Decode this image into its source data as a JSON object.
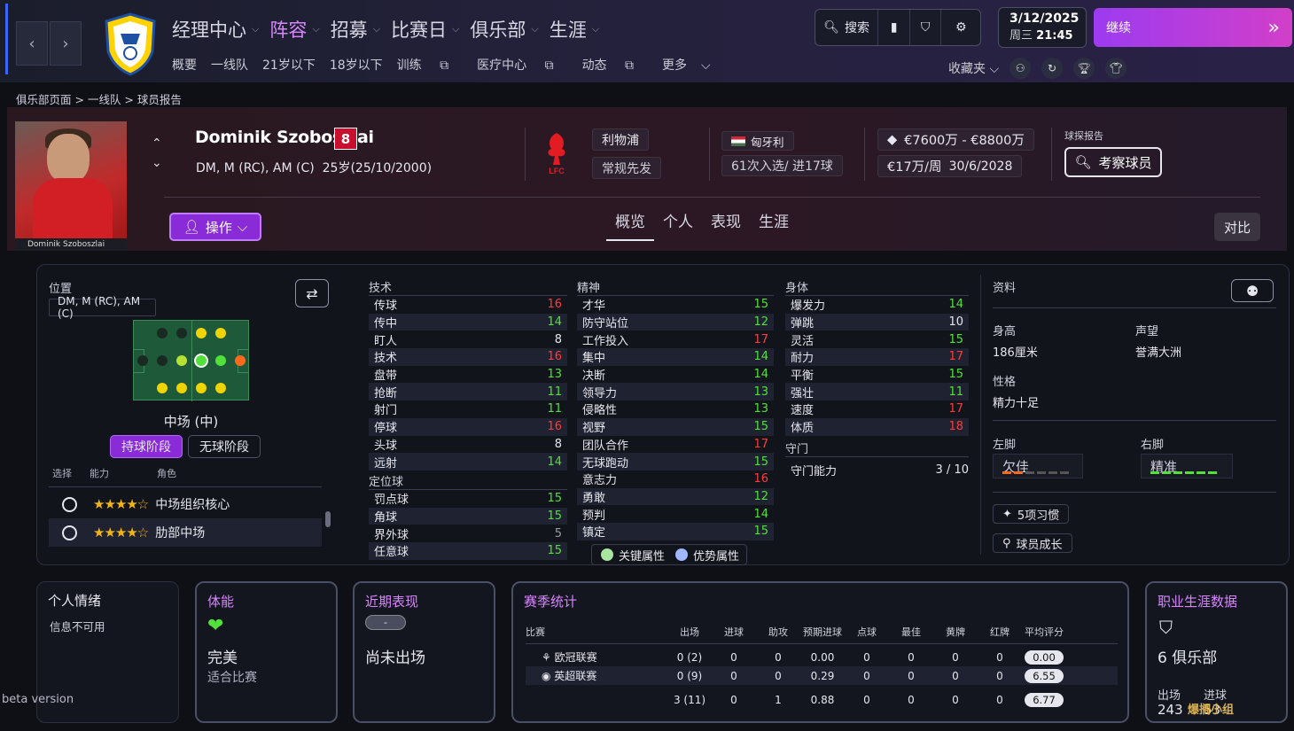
{
  "nav": {
    "main": [
      "经理中心",
      "阵容",
      "招募",
      "比赛日",
      "俱乐部",
      "生涯"
    ],
    "active": 1,
    "sub": [
      "概要",
      "一线队",
      "21岁以下",
      "18岁以下",
      "训练",
      "医疗中心",
      "动态",
      "更多"
    ],
    "search": "搜索",
    "bookmarks": "收藏夹"
  },
  "date": {
    "day": "3/12/2025",
    "weekday": "周三",
    "time": "21:45"
  },
  "continue": "继续",
  "breadcrumb": [
    "俱乐部页面",
    "一线队",
    "球员报告"
  ],
  "player": {
    "name": "Dominik Szoboszlai",
    "number": "8",
    "positions": "DM, M (RC), AM (C)",
    "age": "25岁(25/10/2000)",
    "photo_caption": "Dominik Szoboszlai",
    "club": "利物浦",
    "club_badge_text": "LFC",
    "squad_status": "常规先发",
    "nationality": "匈牙利",
    "caps": "61次入选/ 进17球",
    "value": "€7600万 - €8800万",
    "wage": "€17万/周",
    "contract": "30/6/2028",
    "scout_label": "球探报告",
    "scout_button": "考察球员"
  },
  "actions": "操作",
  "tabs": [
    "概览",
    "个人",
    "表现",
    "生涯"
  ],
  "compare": "对比",
  "position": {
    "label": "位置",
    "value": "DM, M (RC), AM (C)",
    "role": "中场 (中)",
    "phase_on": "持球阶段",
    "phase_off": "无球阶段",
    "hdr_select": "选择",
    "hdr_ability": "能力",
    "hdr_role": "角色",
    "roles": [
      {
        "stars": "★★★★☆",
        "name": "中场组织核心"
      },
      {
        "stars": "★★★★☆",
        "name": "肋部中场"
      }
    ]
  },
  "technical": {
    "title": "技术",
    "items": [
      [
        "传球",
        "16"
      ],
      [
        "传中",
        "14"
      ],
      [
        "盯人",
        "8"
      ],
      [
        "技术",
        "16"
      ],
      [
        "盘带",
        "13"
      ],
      [
        "抢断",
        "11"
      ],
      [
        "射门",
        "11"
      ],
      [
        "停球",
        "16"
      ],
      [
        "头球",
        "8"
      ],
      [
        "远射",
        "14"
      ]
    ]
  },
  "setpieces": {
    "title": "定位球",
    "items": [
      [
        "罚点球",
        "15"
      ],
      [
        "角球",
        "15"
      ],
      [
        "界外球",
        "5"
      ],
      [
        "任意球",
        "15"
      ]
    ]
  },
  "mental": {
    "title": "精神",
    "items": [
      [
        "才华",
        "15"
      ],
      [
        "防守站位",
        "12"
      ],
      [
        "工作投入",
        "17"
      ],
      [
        "集中",
        "14"
      ],
      [
        "决断",
        "14"
      ],
      [
        "领导力",
        "13"
      ],
      [
        "侵略性",
        "13"
      ],
      [
        "视野",
        "15"
      ],
      [
        "团队合作",
        "17"
      ],
      [
        "无球跑动",
        "15"
      ],
      [
        "意志力",
        "16"
      ],
      [
        "勇敢",
        "12"
      ],
      [
        "预判",
        "14"
      ],
      [
        "镇定",
        "15"
      ]
    ]
  },
  "physical": {
    "title": "身体",
    "items": [
      [
        "爆发力",
        "14"
      ],
      [
        "弹跳",
        "10"
      ],
      [
        "灵活",
        "15"
      ],
      [
        "耐力",
        "17"
      ],
      [
        "平衡",
        "15"
      ],
      [
        "强壮",
        "11"
      ],
      [
        "速度",
        "17"
      ],
      [
        "体质",
        "18"
      ]
    ]
  },
  "goalkeeping": {
    "title": "守门",
    "label": "守门能力",
    "value": "3 / 10"
  },
  "legend": {
    "key": "关键属性",
    "strong": "优势属性"
  },
  "info": {
    "title": "资料",
    "height_label": "身高",
    "height": "186厘米",
    "rep_label": "声望",
    "rep": "誉满大洲",
    "pers_label": "性格",
    "pers": "精力十足",
    "left_label": "左脚",
    "left": "欠佳",
    "right_label": "右脚",
    "right": "精准",
    "habits": "5项习惯",
    "growth": "球员成长"
  },
  "mood": {
    "title": "个人情绪",
    "text": "信息不可用"
  },
  "fitness": {
    "title": "体能",
    "status": "完美",
    "sub": "适合比赛"
  },
  "form": {
    "title": "近期表现",
    "badge": "-",
    "text": "尚未出场"
  },
  "season": {
    "title": "赛季统计",
    "headers": [
      "比赛",
      "出场",
      "进球",
      "助攻",
      "预期进球",
      "点球",
      "最佳",
      "黄牌",
      "红牌",
      "平均评分"
    ],
    "rows": [
      [
        "欧冠联赛",
        "0 (2)",
        "0",
        "0",
        "0.00",
        "0",
        "0",
        "0",
        "0",
        "0.00"
      ],
      [
        "英超联赛",
        "0 (9)",
        "0",
        "0",
        "0.29",
        "0",
        "0",
        "0",
        "0",
        "6.55"
      ],
      [
        "",
        "3 (11)",
        "0",
        "1",
        "0.88",
        "0",
        "0",
        "0",
        "0",
        "6.77"
      ]
    ]
  },
  "career": {
    "title": "职业生涯数据",
    "clubs": "6 俱乐部",
    "apps_label": "出场",
    "apps": "243",
    "goals_label": "进球",
    "goals": "53"
  },
  "beta": "beta version",
  "watermark": "爆搁小组",
  "colors": {
    "accent": "#d985ff",
    "purple": "#8a2bd8",
    "red": "#ff3b3b",
    "green": "#52e03a",
    "white": "#e6e6ee"
  }
}
